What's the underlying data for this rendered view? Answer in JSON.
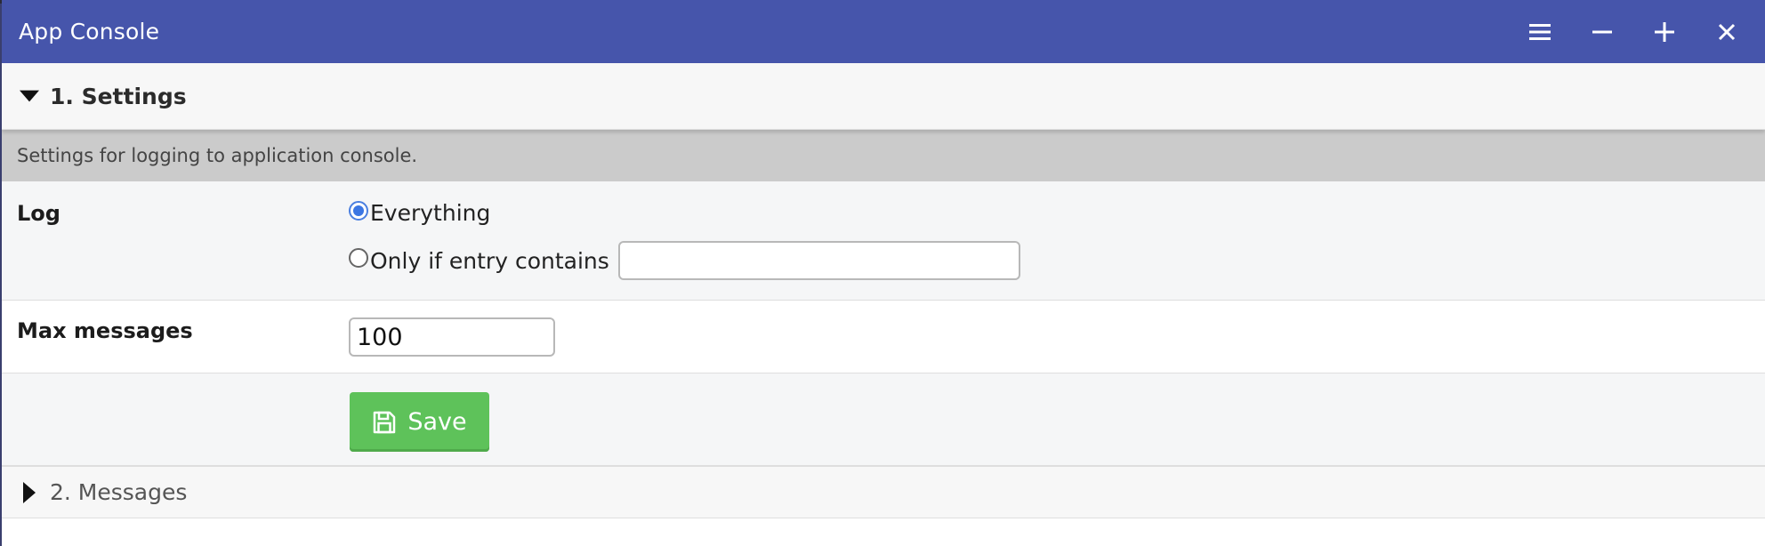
{
  "window": {
    "title": "App Console"
  },
  "window_controls": [
    {
      "name": "menu-icon"
    },
    {
      "name": "minimize-icon"
    },
    {
      "name": "maximize-icon"
    },
    {
      "name": "close-icon"
    }
  ],
  "sections": {
    "settings": {
      "title": "1. Settings",
      "expanded": true,
      "description": "Settings for logging to application console.",
      "log": {
        "label": "Log",
        "option_everything": "Everything",
        "option_contains": "Only if entry contains",
        "selected": "Everything",
        "contains_value": ""
      },
      "max_messages": {
        "label": "Max messages",
        "value": "100"
      },
      "save_label": "Save"
    },
    "messages": {
      "title": "2. Messages",
      "expanded": false
    }
  },
  "colors": {
    "titlebar": "#4655ab",
    "save_button": "#5ec25a",
    "radio_accent": "#3b76e3"
  }
}
